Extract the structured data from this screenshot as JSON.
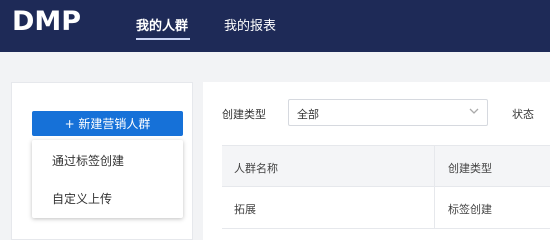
{
  "header": {
    "logo": "DMP",
    "nav": [
      {
        "label": "我的人群",
        "active": true
      },
      {
        "label": "我的报表",
        "active": false
      }
    ]
  },
  "sidebar": {
    "new_button_label": "+ 新建营销人群",
    "menu": [
      {
        "label": "通过标签创建"
      },
      {
        "label": "自定义上传"
      }
    ]
  },
  "filters": {
    "type_label": "创建类型",
    "type_value": "全部",
    "status_label": "状态"
  },
  "table": {
    "columns": [
      "人群名称",
      "创建类型"
    ],
    "rows": [
      [
        "拓展",
        "标签创建"
      ]
    ]
  },
  "colors": {
    "header_bg": "#1e2a57",
    "primary": "#1671d8",
    "content_bg": "#f2f3f5"
  }
}
